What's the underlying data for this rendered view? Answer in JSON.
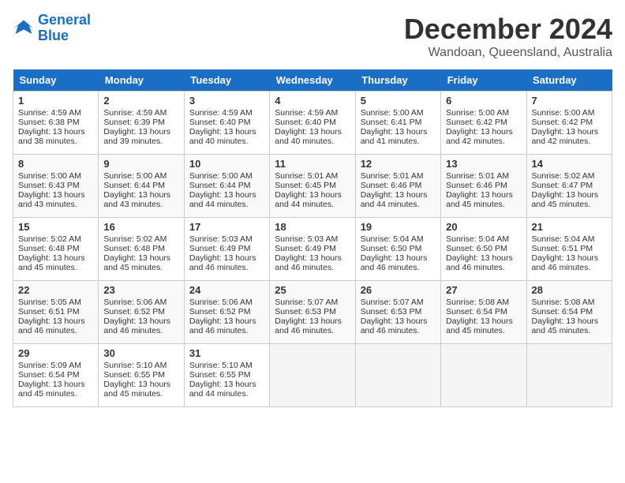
{
  "logo": {
    "line1": "General",
    "line2": "Blue"
  },
  "title": "December 2024",
  "location": "Wandoan, Queensland, Australia",
  "days_of_week": [
    "Sunday",
    "Monday",
    "Tuesday",
    "Wednesday",
    "Thursday",
    "Friday",
    "Saturday"
  ],
  "weeks": [
    [
      {
        "day": "1",
        "sunrise": "4:59 AM",
        "sunset": "6:38 PM",
        "daylight": "13 hours and 38 minutes."
      },
      {
        "day": "2",
        "sunrise": "4:59 AM",
        "sunset": "6:39 PM",
        "daylight": "13 hours and 39 minutes."
      },
      {
        "day": "3",
        "sunrise": "4:59 AM",
        "sunset": "6:40 PM",
        "daylight": "13 hours and 40 minutes."
      },
      {
        "day": "4",
        "sunrise": "4:59 AM",
        "sunset": "6:40 PM",
        "daylight": "13 hours and 40 minutes."
      },
      {
        "day": "5",
        "sunrise": "5:00 AM",
        "sunset": "6:41 PM",
        "daylight": "13 hours and 41 minutes."
      },
      {
        "day": "6",
        "sunrise": "5:00 AM",
        "sunset": "6:42 PM",
        "daylight": "13 hours and 42 minutes."
      },
      {
        "day": "7",
        "sunrise": "5:00 AM",
        "sunset": "6:42 PM",
        "daylight": "13 hours and 42 minutes."
      }
    ],
    [
      {
        "day": "8",
        "sunrise": "5:00 AM",
        "sunset": "6:43 PM",
        "daylight": "13 hours and 43 minutes."
      },
      {
        "day": "9",
        "sunrise": "5:00 AM",
        "sunset": "6:44 PM",
        "daylight": "13 hours and 43 minutes."
      },
      {
        "day": "10",
        "sunrise": "5:00 AM",
        "sunset": "6:44 PM",
        "daylight": "13 hours and 44 minutes."
      },
      {
        "day": "11",
        "sunrise": "5:01 AM",
        "sunset": "6:45 PM",
        "daylight": "13 hours and 44 minutes."
      },
      {
        "day": "12",
        "sunrise": "5:01 AM",
        "sunset": "6:46 PM",
        "daylight": "13 hours and 44 minutes."
      },
      {
        "day": "13",
        "sunrise": "5:01 AM",
        "sunset": "6:46 PM",
        "daylight": "13 hours and 45 minutes."
      },
      {
        "day": "14",
        "sunrise": "5:02 AM",
        "sunset": "6:47 PM",
        "daylight": "13 hours and 45 minutes."
      }
    ],
    [
      {
        "day": "15",
        "sunrise": "5:02 AM",
        "sunset": "6:48 PM",
        "daylight": "13 hours and 45 minutes."
      },
      {
        "day": "16",
        "sunrise": "5:02 AM",
        "sunset": "6:48 PM",
        "daylight": "13 hours and 45 minutes."
      },
      {
        "day": "17",
        "sunrise": "5:03 AM",
        "sunset": "6:49 PM",
        "daylight": "13 hours and 46 minutes."
      },
      {
        "day": "18",
        "sunrise": "5:03 AM",
        "sunset": "6:49 PM",
        "daylight": "13 hours and 46 minutes."
      },
      {
        "day": "19",
        "sunrise": "5:04 AM",
        "sunset": "6:50 PM",
        "daylight": "13 hours and 46 minutes."
      },
      {
        "day": "20",
        "sunrise": "5:04 AM",
        "sunset": "6:50 PM",
        "daylight": "13 hours and 46 minutes."
      },
      {
        "day": "21",
        "sunrise": "5:04 AM",
        "sunset": "6:51 PM",
        "daylight": "13 hours and 46 minutes."
      }
    ],
    [
      {
        "day": "22",
        "sunrise": "5:05 AM",
        "sunset": "6:51 PM",
        "daylight": "13 hours and 46 minutes."
      },
      {
        "day": "23",
        "sunrise": "5:06 AM",
        "sunset": "6:52 PM",
        "daylight": "13 hours and 46 minutes."
      },
      {
        "day": "24",
        "sunrise": "5:06 AM",
        "sunset": "6:52 PM",
        "daylight": "13 hours and 46 minutes."
      },
      {
        "day": "25",
        "sunrise": "5:07 AM",
        "sunset": "6:53 PM",
        "daylight": "13 hours and 46 minutes."
      },
      {
        "day": "26",
        "sunrise": "5:07 AM",
        "sunset": "6:53 PM",
        "daylight": "13 hours and 46 minutes."
      },
      {
        "day": "27",
        "sunrise": "5:08 AM",
        "sunset": "6:54 PM",
        "daylight": "13 hours and 45 minutes."
      },
      {
        "day": "28",
        "sunrise": "5:08 AM",
        "sunset": "6:54 PM",
        "daylight": "13 hours and 45 minutes."
      }
    ],
    [
      {
        "day": "29",
        "sunrise": "5:09 AM",
        "sunset": "6:54 PM",
        "daylight": "13 hours and 45 minutes."
      },
      {
        "day": "30",
        "sunrise": "5:10 AM",
        "sunset": "6:55 PM",
        "daylight": "13 hours and 45 minutes."
      },
      {
        "day": "31",
        "sunrise": "5:10 AM",
        "sunset": "6:55 PM",
        "daylight": "13 hours and 44 minutes."
      },
      null,
      null,
      null,
      null
    ]
  ],
  "labels": {
    "sunrise": "Sunrise:",
    "sunset": "Sunset:",
    "daylight": "Daylight:"
  }
}
